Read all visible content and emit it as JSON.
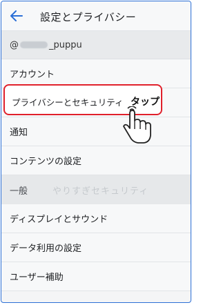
{
  "header": {
    "title": "設定とプライバシー"
  },
  "account": {
    "prefix": "@",
    "suffix": "_puppu"
  },
  "items": [
    {
      "label": "アカウント"
    },
    {
      "label": "プライバシーとセキュリティ"
    },
    {
      "label": "通知"
    },
    {
      "label": "コンテンツの設定"
    }
  ],
  "section": {
    "label": "一般",
    "watermark": "やりすぎセキュリティ"
  },
  "general_items": [
    {
      "label": "ディスプレイとサウンド"
    },
    {
      "label": "データ利用の設定"
    },
    {
      "label": "ユーザー補助"
    }
  ],
  "annotation": {
    "tap_label": "タップ"
  },
  "colors": {
    "accent": "#2b6fd6",
    "highlight": "#e0202b"
  }
}
